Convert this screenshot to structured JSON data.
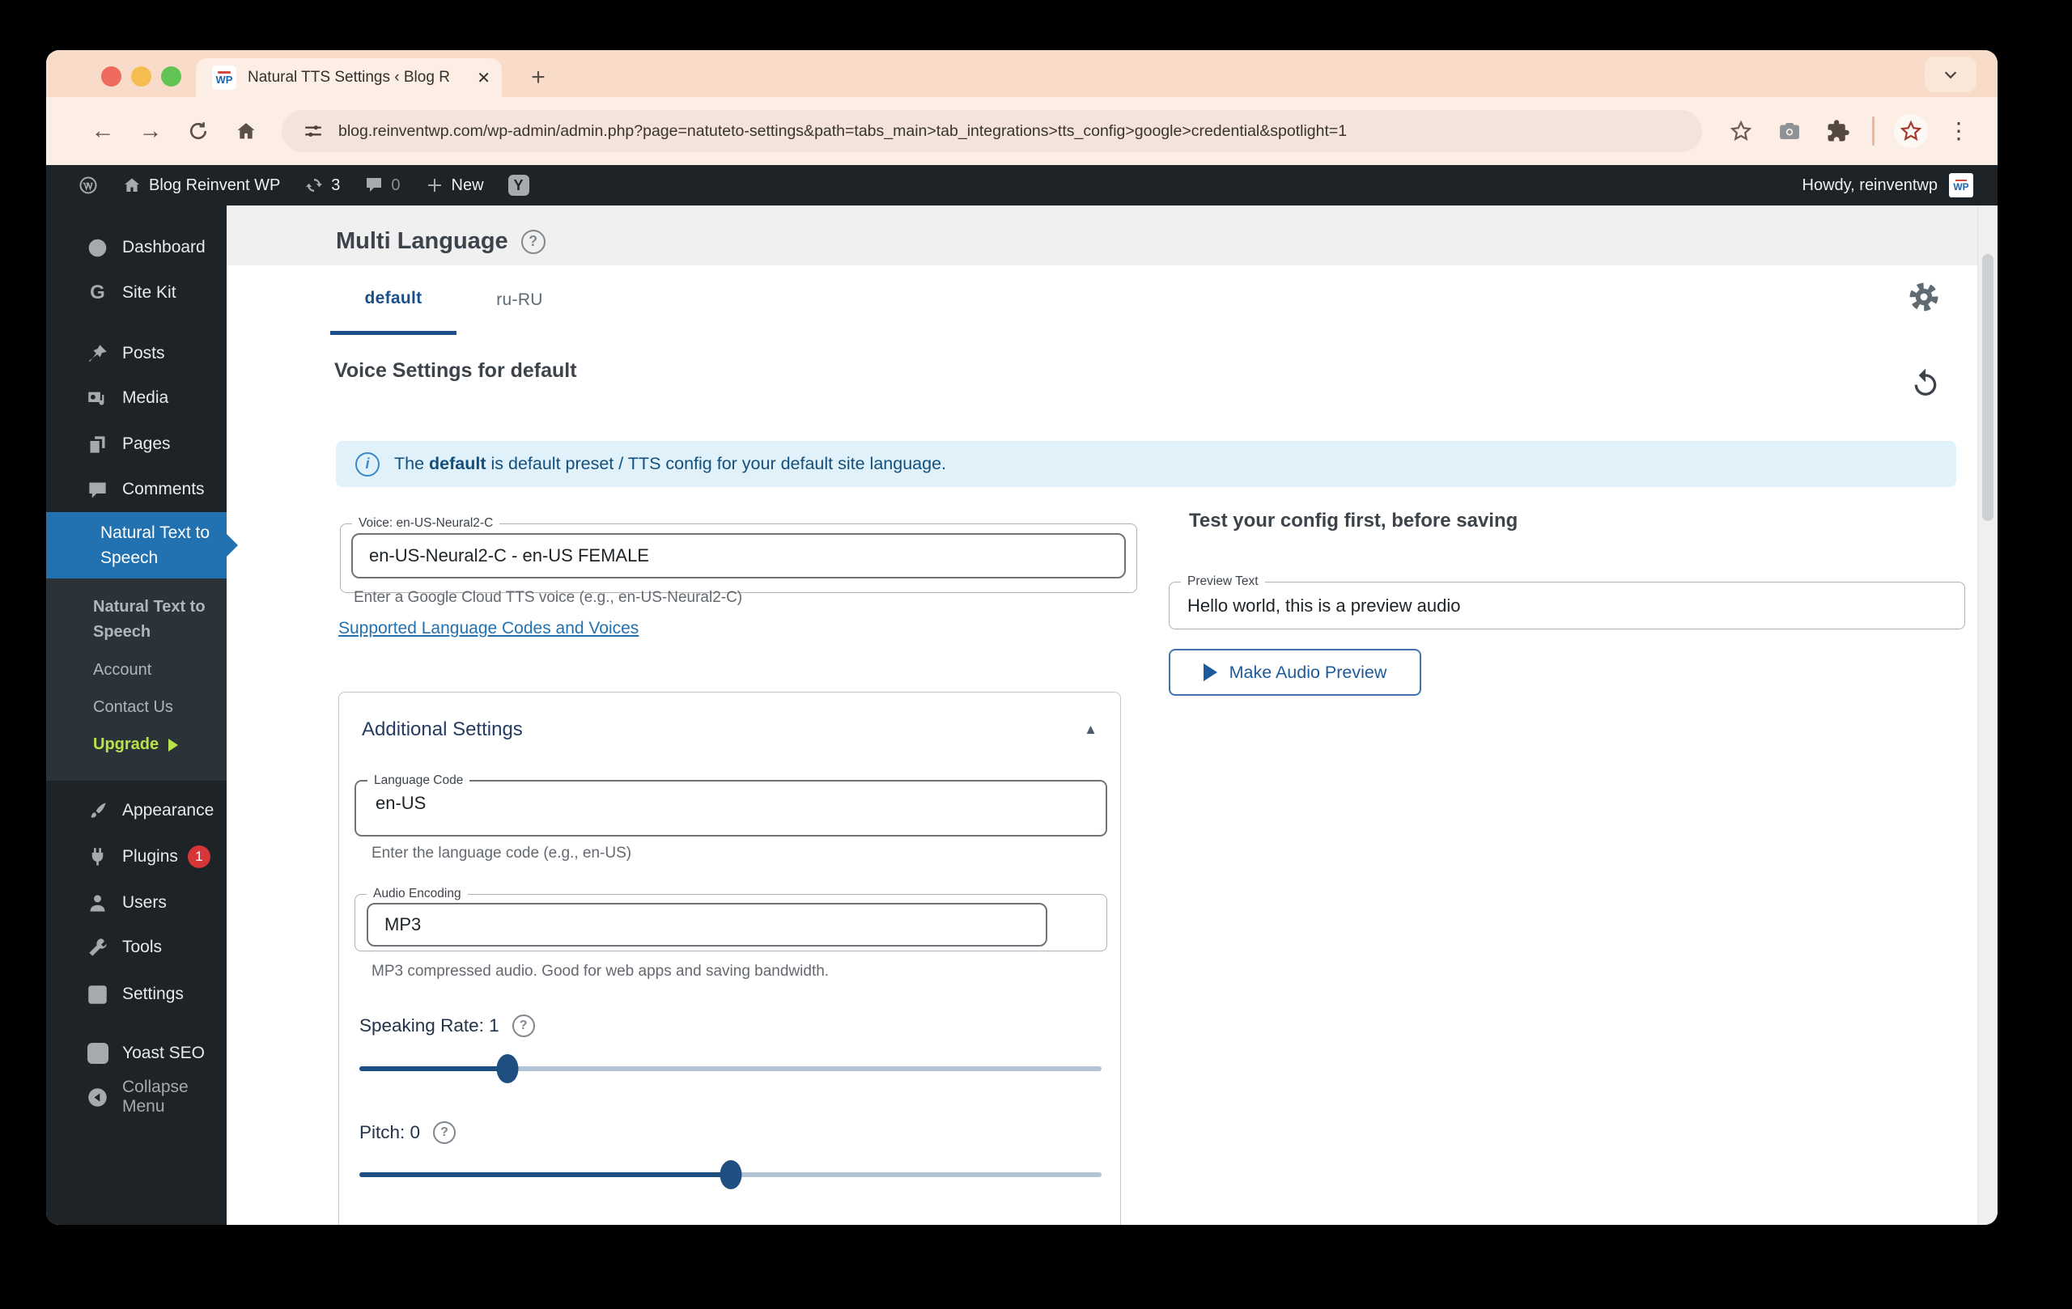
{
  "chrome": {
    "tab_title": "Natural TTS Settings ‹ Blog R",
    "favicon_text": "WP",
    "url": "blog.reinventwp.com/wp-admin/admin.php?page=natuteto-settings&path=tabs_main>tab_integrations>tts_config>google>credential&spotlight=1"
  },
  "icons": {
    "close": "✕",
    "plus": "+",
    "back": "←",
    "forward": "→",
    "dots": "⋮",
    "help": "?",
    "info": "i",
    "collapse_up": "▲",
    "g_letter": "G",
    "y_letter": "Y",
    "w_letter": "W"
  },
  "admin_bar": {
    "site_name": "Blog Reinvent WP",
    "updates_count": "3",
    "comments_count": "0",
    "new_label": "New",
    "howdy": "Howdy, reinventwp",
    "avatar_text": "WP"
  },
  "sidebar": {
    "items": [
      {
        "label": "Dashboard"
      },
      {
        "label": "Site Kit"
      },
      {
        "label": "Posts"
      },
      {
        "label": "Media"
      },
      {
        "label": "Pages"
      },
      {
        "label": "Comments"
      },
      {
        "label": "Natural Text to Speech"
      },
      {
        "label": "Appearance"
      },
      {
        "label": "Plugins",
        "badge": "1"
      },
      {
        "label": "Users"
      },
      {
        "label": "Tools"
      },
      {
        "label": "Settings"
      },
      {
        "label": "Yoast SEO"
      },
      {
        "label": "Collapse Menu"
      }
    ],
    "submenu": [
      {
        "label": "Natural Text to Speech"
      },
      {
        "label": "Account"
      },
      {
        "label": "Contact Us"
      },
      {
        "label": "Upgrade"
      }
    ]
  },
  "main": {
    "page_title": "Multi Language",
    "tabs": [
      {
        "label": "default"
      },
      {
        "label": "ru-RU"
      }
    ],
    "section_title": "Voice Settings for default",
    "banner": {
      "prefix": "The ",
      "bold": "default",
      "suffix": " is default preset / TTS config for your default site language."
    },
    "voice": {
      "legend": "Voice: en-US-Neural2-C",
      "value": "en-US-Neural2-C - en-US FEMALE",
      "helper": "Enter a Google Cloud TTS voice (e.g., en-US-Neural2-C)"
    },
    "voices_link": "Supported Language Codes and Voices",
    "additional": {
      "title": "Additional Settings",
      "language_code": {
        "legend": "Language Code",
        "value": "en-US",
        "helper": "Enter the language code (e.g., en-US)"
      },
      "audio_encoding": {
        "legend": "Audio Encoding",
        "value": "MP3",
        "helper": "MP3 compressed audio. Good for web apps and saving bandwidth."
      },
      "speaking_rate": {
        "label": "Speaking Rate: 1",
        "percent": 20
      },
      "pitch": {
        "label": "Pitch: 0",
        "percent": 50
      }
    },
    "test": {
      "title": "Test your config first, before saving",
      "preview": {
        "legend": "Preview Text",
        "value": "Hello world, this is a preview audio"
      },
      "button_label": "Make Audio Preview"
    }
  },
  "colors": {
    "wp_admin_dark": "#1d2327",
    "wp_accent_blue": "#2271b1",
    "slider_blue": "#1f4e80",
    "upgrade_green": "#b8e24b",
    "badge_red": "#d63638",
    "banner_bg": "#e0f1fa",
    "chrome_peach": "#f8dcc9"
  }
}
